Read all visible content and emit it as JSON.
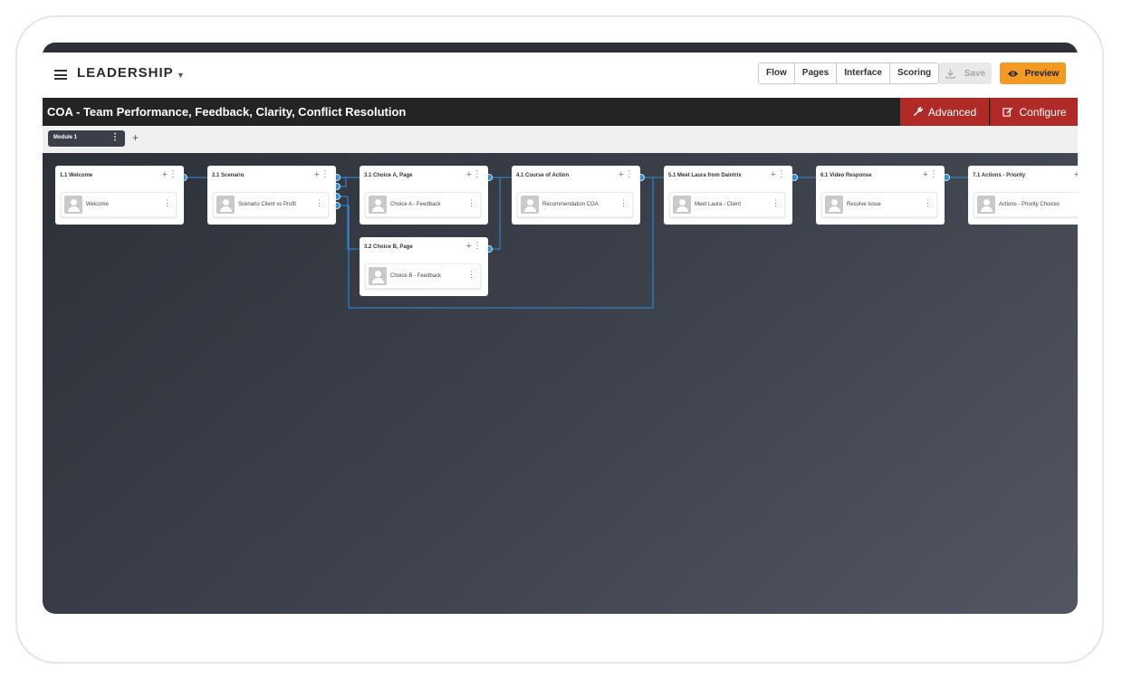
{
  "app": {
    "title": "LEADERSHIP"
  },
  "nav": {
    "tabs": [
      "Flow",
      "Pages",
      "Interface",
      "Scoring"
    ],
    "save_label": "Save",
    "preview_label": "Preview"
  },
  "header": {
    "title": "COA - Team Performance, Feedback, Clarity, Conflict Resolution",
    "advanced_label": "Advanced",
    "configure_label": "Configure"
  },
  "modules": {
    "tabs": [
      {
        "label": "Module 1"
      }
    ],
    "add_label": "+"
  },
  "flow": {
    "cards": [
      {
        "title": "1.1 Welcome",
        "item": "Welcome"
      },
      {
        "title": "2.1 Scenario",
        "item": "Scenario Client vs Profit"
      },
      {
        "title": "3.1 Choice A, Page",
        "item": "Choice A - Feedback"
      },
      {
        "title": "4.1 Course of Action",
        "item": "Recommendation COA"
      },
      {
        "title": "5.1 Meet Laura from Daintrix",
        "item": "Meet Laura - Client"
      },
      {
        "title": "6.1 Video Response",
        "item": "Resolve Issue"
      },
      {
        "title": "7.1 Actions - Priority",
        "item": "Actions - Priority Choices"
      },
      {
        "title": "3.2 Choice B, Page",
        "item": "Choice B - Feedback"
      }
    ]
  },
  "colors": {
    "accent": "#f39a22",
    "danger": "#b02b27",
    "connector": "#2f8fe0",
    "titlebar": "#242424"
  }
}
